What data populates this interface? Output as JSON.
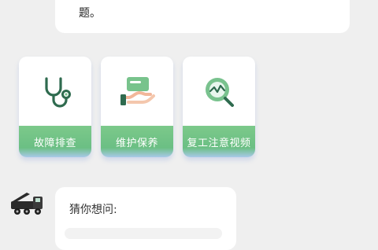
{
  "top_message": {
    "text": "题。"
  },
  "quick_actions": [
    {
      "label": "故障排查",
      "icon": "stethoscope-icon"
    },
    {
      "label": "维护保养",
      "icon": "hand-card-icon"
    },
    {
      "label": "复工注意视频",
      "icon": "magnifier-chart-icon"
    }
  ],
  "assistant": {
    "avatar": "truck-avatar-icon",
    "prompt_title": "猜你想问:"
  },
  "colors": {
    "accent": "#6bbf84",
    "background": "#efefef"
  }
}
